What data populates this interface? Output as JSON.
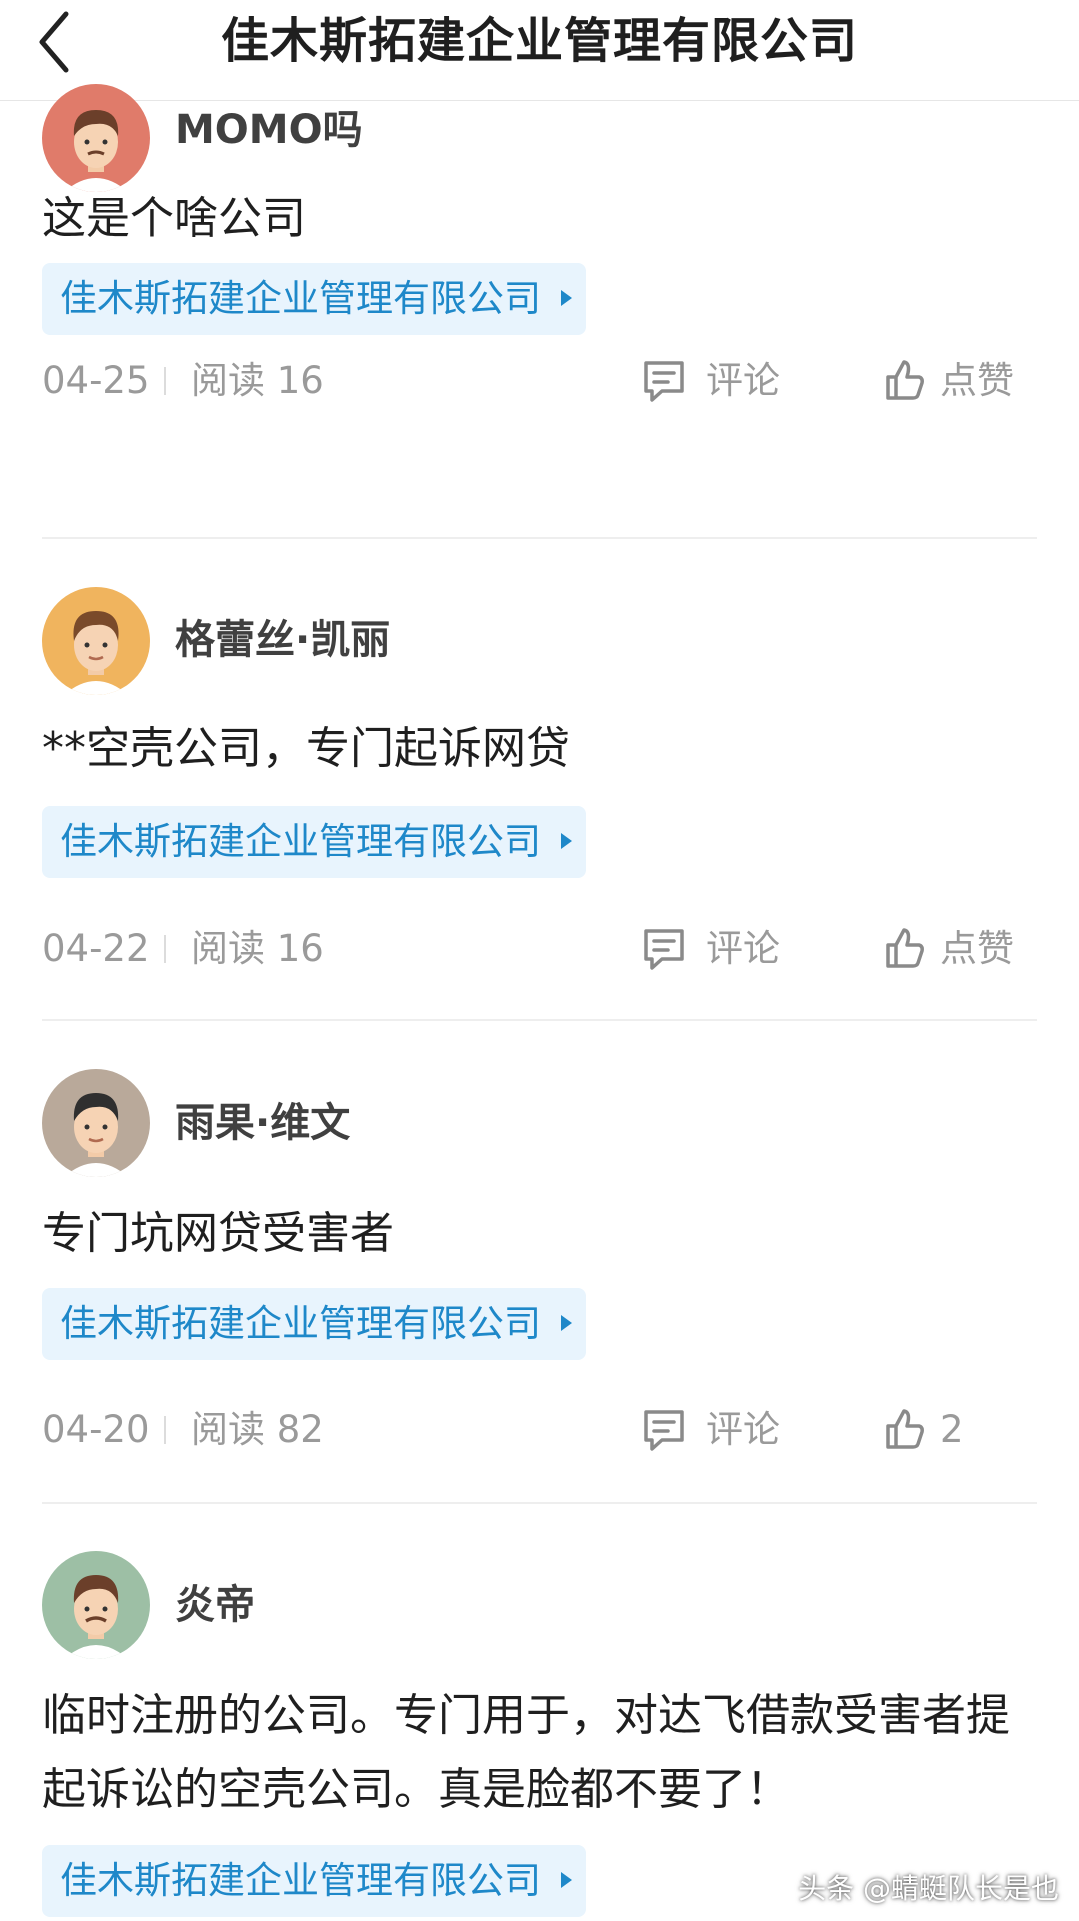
{
  "header": {
    "back_icon": "chevron-left-icon",
    "title": "佳木斯拓建企业管理有限公司"
  },
  "colors": {
    "tag_bg": "#e8f4fd",
    "tag_text": "#1e88c9",
    "meta_text": "#9a9a9a"
  },
  "posts": [
    {
      "username": "MOMO吗",
      "content": "这是个啥公司",
      "tag": "佳木斯拓建企业管理有限公司",
      "date": "04-25",
      "reads": "阅读 16",
      "comment": "评论",
      "like": "点赞"
    },
    {
      "username": "格蕾丝·凯丽",
      "content": "**空壳公司，专门起诉网贷",
      "tag": "佳木斯拓建企业管理有限公司",
      "date": "04-22",
      "reads": "阅读 16",
      "comment": "评论",
      "like": "点赞"
    },
    {
      "username": "雨果·维文",
      "content": "专门坑网贷受害者",
      "tag": "佳木斯拓建企业管理有限公司",
      "date": "04-20",
      "reads": "阅读 82",
      "comment": "评论",
      "like": "2"
    },
    {
      "username": "炎帝",
      "content": "临时注册的公司。专门用于，对达飞借款受害者提起诉讼的空壳公司。真是脸都不要了！",
      "tag": "佳木斯拓建企业管理有限公司"
    }
  ],
  "watermark": "头条 @蜻蜓队长是也"
}
